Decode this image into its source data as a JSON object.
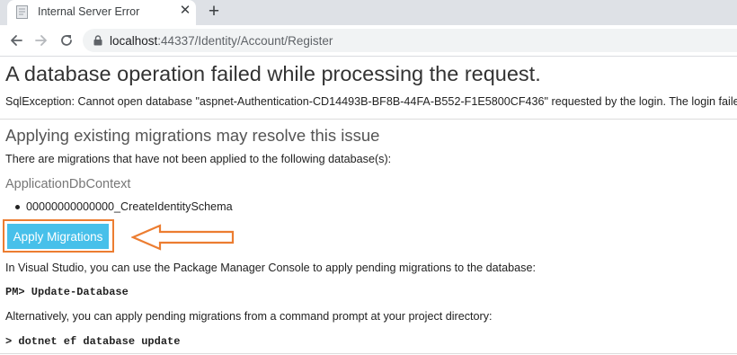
{
  "browser": {
    "tab": {
      "title": "Internal Server Error",
      "favicon": "document-icon",
      "close": "✕"
    },
    "new_tab": "+",
    "address": {
      "host": "localhost",
      "port": ":44337",
      "path": "/Identity/Account/Register"
    },
    "icons": [
      "back-arrow-icon",
      "forward-arrow-icon",
      "reload-icon",
      "lock-icon"
    ]
  },
  "page": {
    "heading": "A database operation failed while processing the request.",
    "exception": "SqlException: Cannot open database \"aspnet-Authentication-CD14493B-BF8B-44FA-B552-F1E5800CF436\" requested by the login. The login failed. Login failed fo",
    "subheading": "Applying existing migrations may resolve this issue",
    "pending_text": "There are migrations that have not been applied to the following database(s):",
    "context_name": "ApplicationDbContext",
    "migrations": [
      "00000000000000_CreateIdentitySchema"
    ],
    "apply_button": "Apply Migrations",
    "vs_text": "In Visual Studio, you can use the Package Manager Console to apply pending migrations to the database:",
    "pmc_command": "PM> Update-Database",
    "alt_text": "Alternatively, you can apply pending migrations from a command prompt at your project directory:",
    "cli_command": "> dotnet ef database update"
  },
  "colors": {
    "button_bg": "#47c0ea",
    "annotation": "#ec7d31",
    "tabstrip": "#dee1e6",
    "omnibox": "#f1f3f4"
  }
}
